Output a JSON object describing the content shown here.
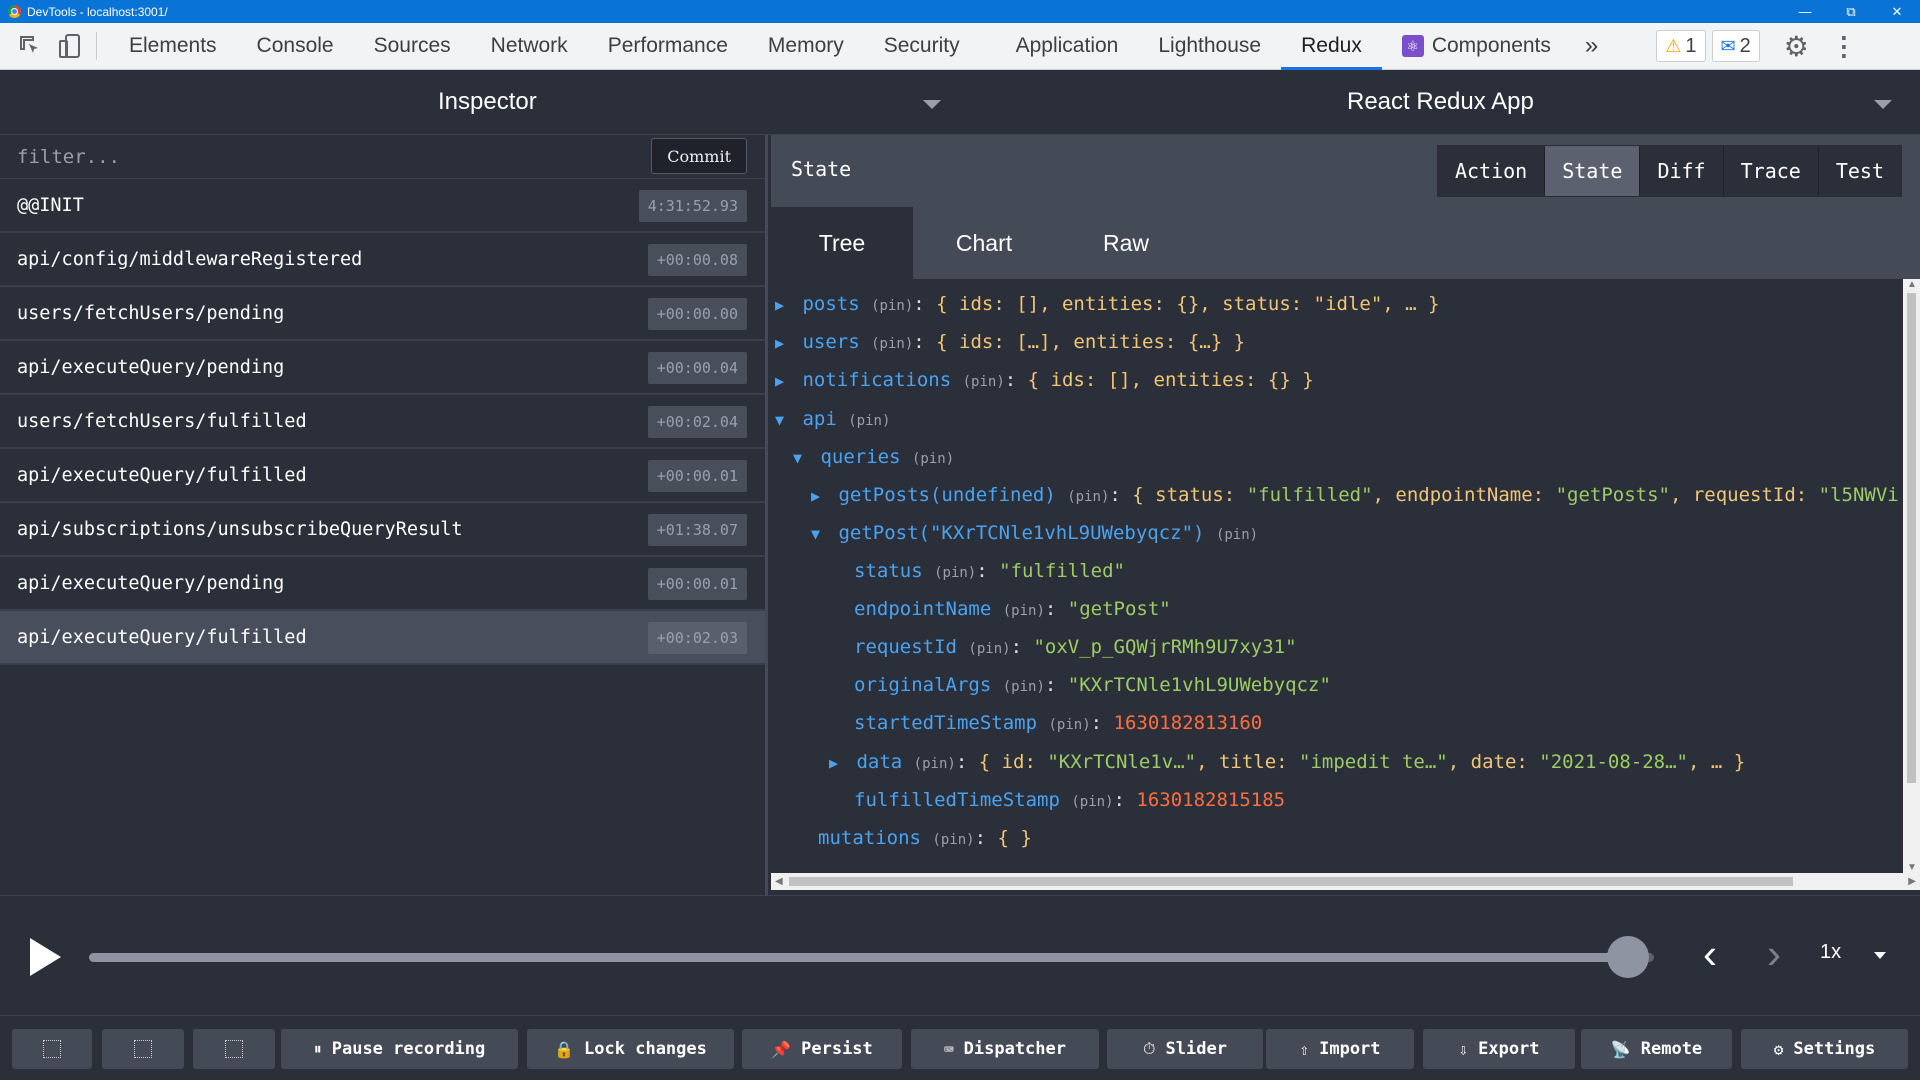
{
  "window": {
    "title": "DevTools - localhost:3001/"
  },
  "devtools_tabs": [
    "Elements",
    "Console",
    "Sources",
    "Network",
    "Performance",
    "Memory",
    "Security",
    "Application",
    "Lighthouse",
    "Redux",
    "Components"
  ],
  "active_tab": "Redux",
  "badges": {
    "warnings": "1",
    "messages": "2"
  },
  "header": {
    "left_title": "Inspector",
    "right_title": "React Redux App"
  },
  "filter": {
    "placeholder": "filter...",
    "commit_label": "Commit"
  },
  "actions": [
    {
      "name": "@@INIT",
      "time": "4:31:52.93"
    },
    {
      "name": "api/config/middlewareRegistered",
      "time": "+00:00.08"
    },
    {
      "name": "users/fetchUsers/pending",
      "time": "+00:00.00"
    },
    {
      "name": "api/executeQuery/pending",
      "time": "+00:00.04"
    },
    {
      "name": "users/fetchUsers/fulfilled",
      "time": "+00:02.04"
    },
    {
      "name": "api/executeQuery/fulfilled",
      "time": "+00:00.01"
    },
    {
      "name": "api/subscriptions/unsubscribeQueryResult",
      "time": "+01:38.07"
    },
    {
      "name": "api/executeQuery/pending",
      "time": "+00:00.01"
    },
    {
      "name": "api/executeQuery/fulfilled",
      "time": "+00:02.03"
    }
  ],
  "selected_action_index": 8,
  "state_panel": {
    "label": "State",
    "modes": [
      "Action",
      "State",
      "Diff",
      "Trace",
      "Test"
    ],
    "active_mode": "State",
    "subtabs": [
      "Tree",
      "Chart",
      "Raw"
    ],
    "active_subtab": "Tree"
  },
  "tree": {
    "pin": "(pin)",
    "posts": {
      "key": "posts",
      "summary": "{ ids: [], entities: {}, status: \"idle\", … }"
    },
    "users": {
      "key": "users",
      "summary": "{ ids: […], entities: {…} }"
    },
    "notifications": {
      "key": "notifications",
      "summary": "{ ids: [], entities: {} }"
    },
    "api": {
      "key": "api"
    },
    "queries": {
      "key": "queries"
    },
    "getPosts": {
      "key": "getPosts(undefined)",
      "summary_a": "{ status: ",
      "status": "\"fulfilled\"",
      "summary_b": ", endpointName: ",
      "endpoint": "\"getPosts\"",
      "summary_c": ", requestId: ",
      "request": "\"l5NWVi"
    },
    "getPost": {
      "key": "getPost(\"KXrTCNle1vhL9UWebyqcz\")"
    },
    "status": {
      "key": "status",
      "value": "\"fulfilled\""
    },
    "endpointName": {
      "key": "endpointName",
      "value": "\"getPost\""
    },
    "requestId": {
      "key": "requestId",
      "value": "\"oxV_p_GQWjrRMh9U7xy31\""
    },
    "originalArgs": {
      "key": "originalArgs",
      "value": "\"KXrTCNle1vhL9UWebyqcz\""
    },
    "startedTimeStamp": {
      "key": "startedTimeStamp",
      "value": "1630182813160"
    },
    "data": {
      "key": "data",
      "summary_a": "{ id: ",
      "id": "\"KXrTCNle1v…\"",
      "summary_b": ", title: ",
      "title": "\"impedit te…\"",
      "summary_c": ", date: ",
      "date": "\"2021-08-28…\"",
      "summary_d": ", … }"
    },
    "fulfilledTimeStamp": {
      "key": "fulfilledTimeStamp",
      "value": "1630182815185"
    },
    "mutations": {
      "key": "mutations",
      "summary": "{ }"
    }
  },
  "slider": {
    "position": 1.0,
    "speed": "1x"
  },
  "toolbar": {
    "pause": "Pause recording",
    "lock": "Lock changes",
    "persist": "Persist",
    "dispatcher": "Dispatcher",
    "slider": "Slider",
    "import": "Import",
    "export": "Export",
    "remote": "Remote",
    "settings": "Settings"
  }
}
